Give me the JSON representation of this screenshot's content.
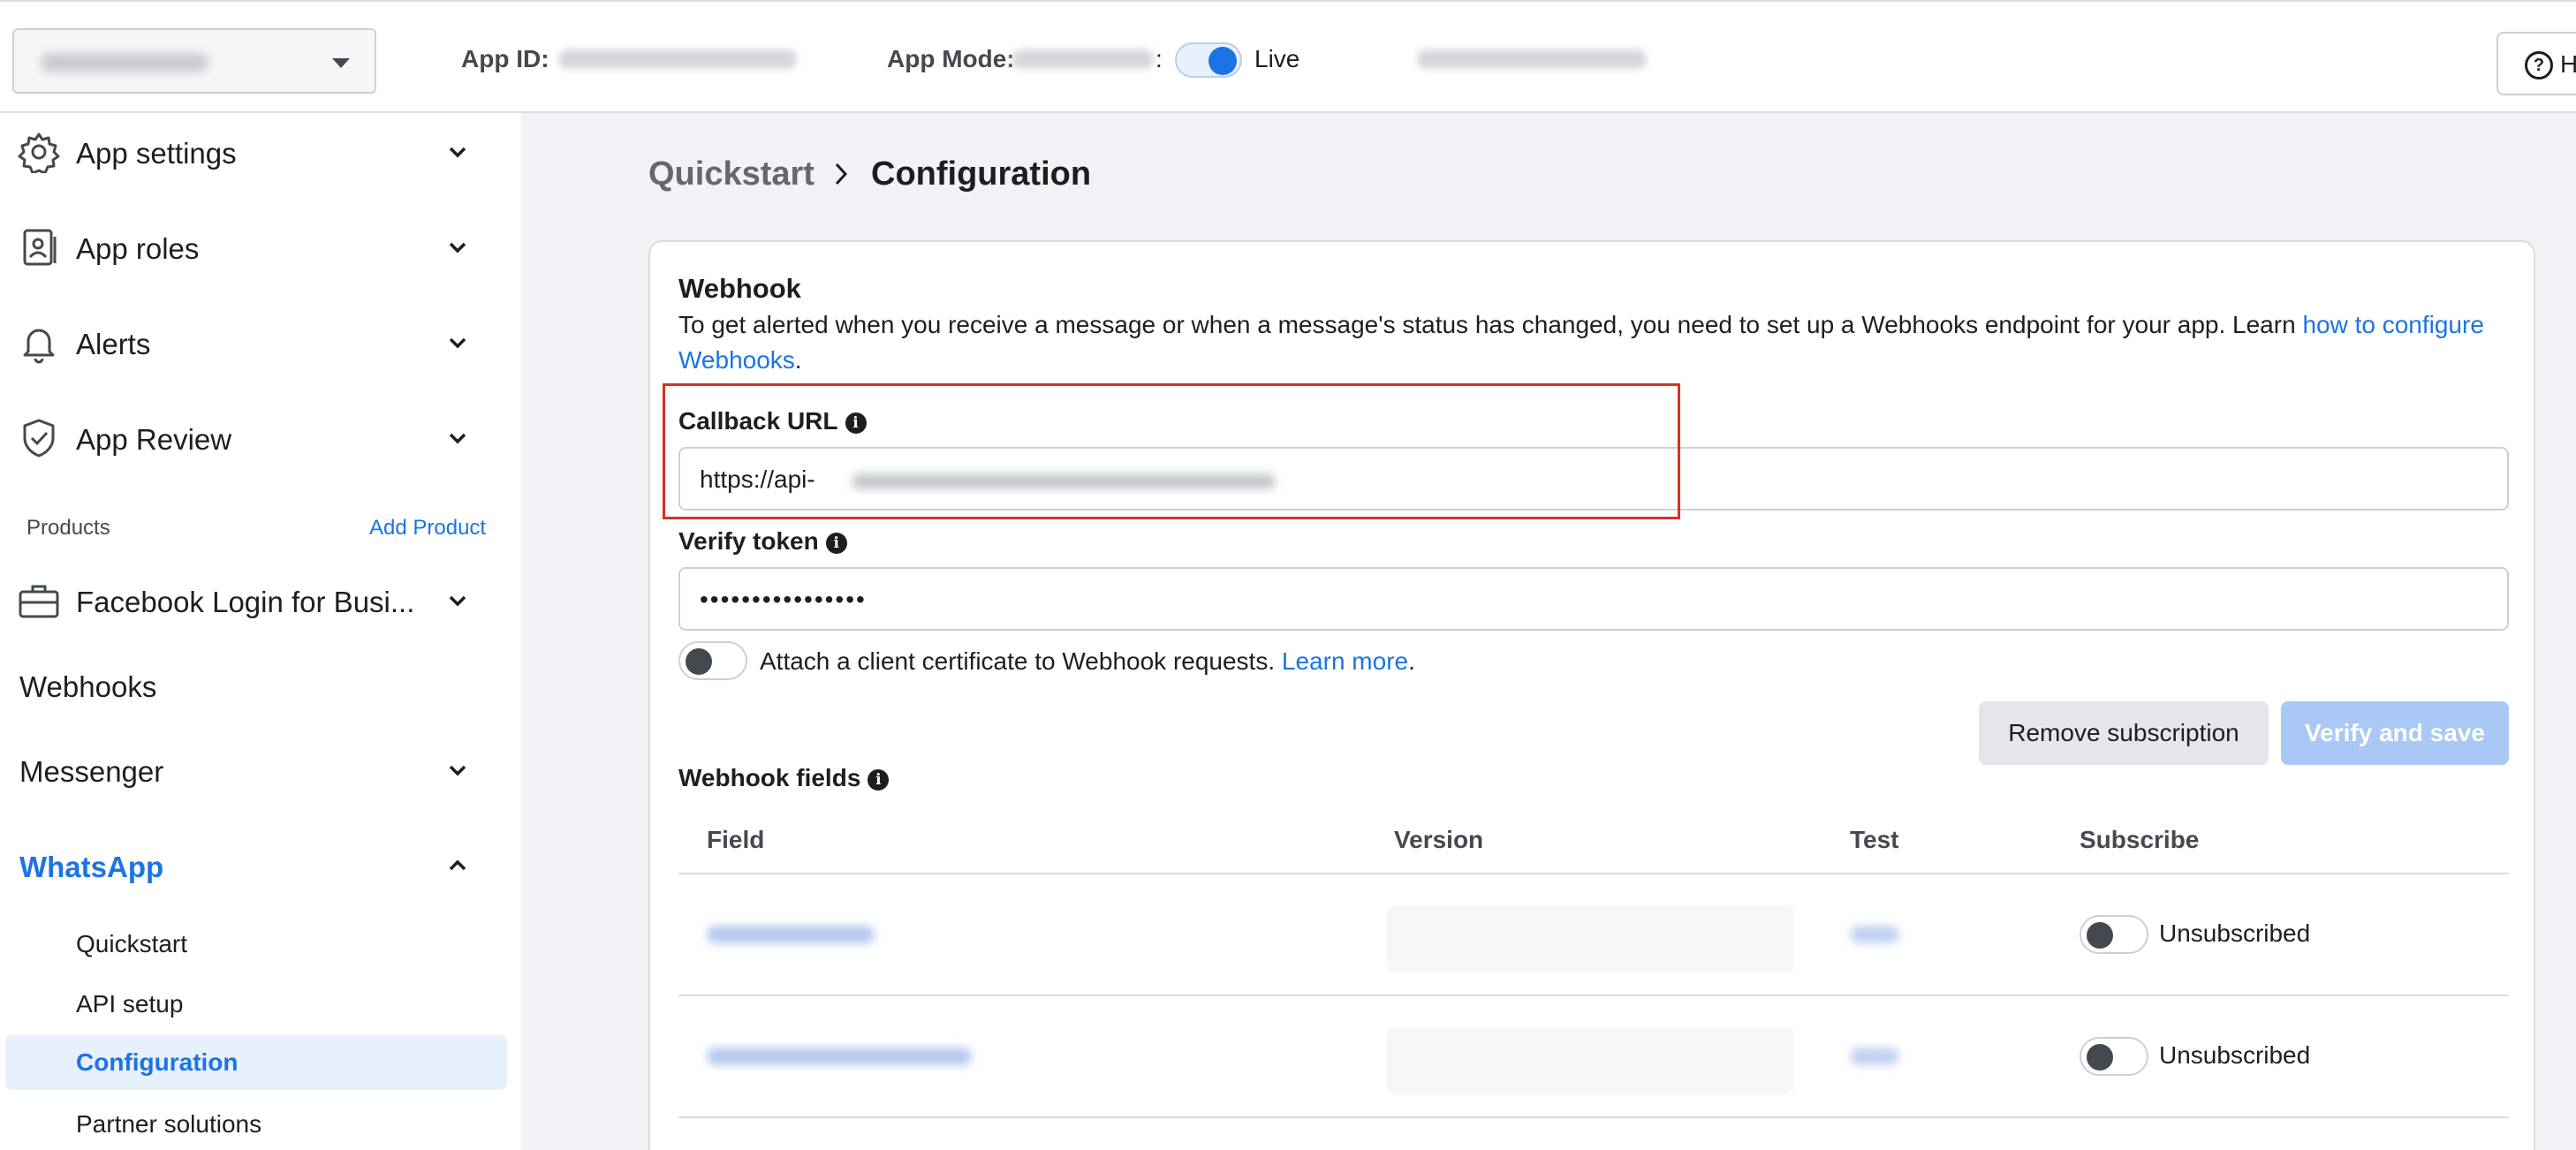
{
  "topbar": {
    "app_id_label": "App ID:",
    "app_mode_label": "App Mode:",
    "mode_separator": ":",
    "mode_value": "Live",
    "help_label": "H"
  },
  "sidebar": {
    "items": [
      {
        "label": "App settings",
        "icon": "gear-icon"
      },
      {
        "label": "App roles",
        "icon": "badge-icon"
      },
      {
        "label": "Alerts",
        "icon": "bell-icon"
      },
      {
        "label": "App Review",
        "icon": "shield-check-icon"
      }
    ],
    "products_label": "Products",
    "add_product_label": "Add Product",
    "products": [
      {
        "label": "Facebook Login for Busi...",
        "icon": "briefcase-icon"
      },
      {
        "label": "Webhooks"
      },
      {
        "label": "Messenger"
      },
      {
        "label": "WhatsApp"
      }
    ],
    "whatsapp_sub": [
      "Quickstart",
      "API setup",
      "Configuration",
      "Partner solutions"
    ]
  },
  "breadcrumb": {
    "parent": "Quickstart",
    "current": "Configuration"
  },
  "webhook": {
    "title": "Webhook",
    "description": "To get alerted when you receive a message or when a message's status has changed, you need to set up a Webhooks endpoint for your app. Learn ",
    "description_link": "how to configure Webhooks",
    "description_end": ".",
    "callback_label": "Callback URL",
    "callback_value": "https://api-",
    "verify_label": "Verify token",
    "verify_value": "••••••••••••••••",
    "cert_text": "Attach a client certificate to Webhook requests. ",
    "cert_link": "Learn more",
    "cert_end": ".",
    "remove_button": "Remove subscription",
    "verify_button": "Verify and save"
  },
  "fields": {
    "title": "Webhook fields",
    "columns": [
      "Field",
      "Version",
      "Test",
      "Subscribe"
    ],
    "rows": [
      {
        "status": "Unsubscribed"
      },
      {
        "status": "Unsubscribed"
      }
    ]
  },
  "colors": {
    "accent": "#1b74e4",
    "highlight_border": "#d93025",
    "verify_disabled": "#a9c8f5"
  }
}
